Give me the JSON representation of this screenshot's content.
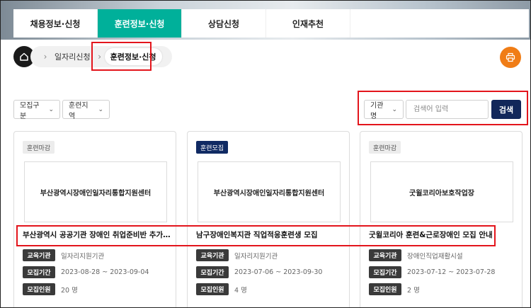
{
  "tabs": [
    {
      "label": "채용정보·신청",
      "active": false
    },
    {
      "label": "훈련정보·신청",
      "active": true
    },
    {
      "label": "상담신청",
      "active": false
    },
    {
      "label": "인재추천",
      "active": false
    }
  ],
  "breadcrumb": {
    "home_icon": "home-icon",
    "items": [
      "일자리신청",
      "훈련정보·신청"
    ]
  },
  "print_icon": "print-icon",
  "filters": {
    "category": "모집구분",
    "region": "훈련지역"
  },
  "search": {
    "scope": "기관명",
    "placeholder": "검색어 입력",
    "value": "",
    "button": "검색"
  },
  "cards": [
    {
      "status": "훈련마감",
      "status_type": "closed",
      "org_logo": "부산광역시장애인일자리통합지원센터",
      "title": "부산광역시 공공기관 장애인 취업준비반 추가 모집",
      "rows": [
        {
          "label": "교육기관",
          "value": "일자리지원기관"
        },
        {
          "label": "모집기간",
          "value": "2023-08-28 ~ 2023-09-04"
        },
        {
          "label": "모집인원",
          "value": "20 명"
        }
      ]
    },
    {
      "status": "훈련모집",
      "status_type": "open",
      "org_logo": "부산광역시장애인일자리통합지원센터",
      "title": "남구장애인복지관 직업적응훈련생 모집",
      "rows": [
        {
          "label": "교육기관",
          "value": "일자리지원기관"
        },
        {
          "label": "모집기간",
          "value": "2023-07-06 ~ 2023-09-30"
        },
        {
          "label": "모집인원",
          "value": "4 명"
        }
      ]
    },
    {
      "status": "훈련마감",
      "status_type": "closed",
      "org_logo": "굿윌코리아보호작업장",
      "title": "굿윌코리아 훈련&근로장애인 모집 안내",
      "rows": [
        {
          "label": "교육기관",
          "value": "장애인직업재활시설"
        },
        {
          "label": "모집기간",
          "value": "2023-07-12 ~ 2023-07-28"
        },
        {
          "label": "모집인원",
          "value": "2 명"
        }
      ]
    }
  ]
}
